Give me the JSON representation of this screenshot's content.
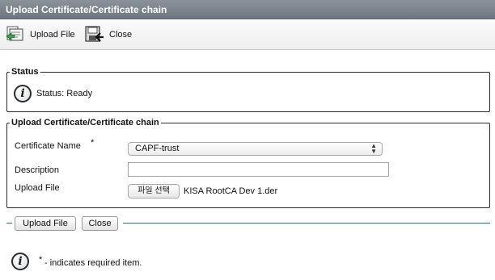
{
  "window": {
    "title": "Upload Certificate/Certificate chain"
  },
  "toolbar": {
    "upload_label": "Upload File",
    "close_label": "Close"
  },
  "status": {
    "legend": "Status",
    "message": "Status: Ready"
  },
  "form": {
    "legend": "Upload Certificate/Certificate chain",
    "cert_name_label": "Certificate Name",
    "required_mark": "*",
    "cert_name_value": "CAPF-trust",
    "description_label": "Description",
    "description_value": "",
    "upload_file_label": "Upload File",
    "file_button_label": "파일 선택",
    "file_name": "KISA RootCA Dev 1.der"
  },
  "actions": {
    "upload_label": "Upload File",
    "close_label": "Close"
  },
  "footer": {
    "required_mark": "*",
    "note": "- indicates required item."
  },
  "icons": {
    "upload": "upload-file-icon",
    "close": "close-window-icon",
    "info": "info-icon"
  },
  "colors": {
    "title_bar": "#7a838c",
    "separator": "#3f6f74"
  }
}
